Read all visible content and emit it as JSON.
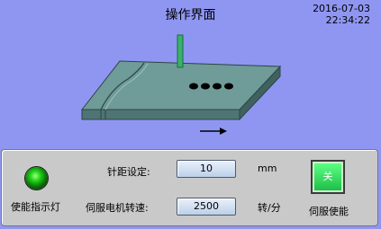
{
  "header": {
    "title": "操作界面",
    "date": "2016-07-03",
    "time": "22:34:22"
  },
  "scene": {
    "holes": 4,
    "arrow_icon": "arrow-right-icon",
    "colors": {
      "table_top": "#6f9b98",
      "table_side": "#4e7573",
      "needle": "#36b36a",
      "hole": "#000000"
    }
  },
  "panel": {
    "indicator_label": "使能指示灯",
    "indicator_state": "on",
    "stitch_spacing": {
      "label": "针距设定:",
      "value": "10",
      "unit": "mm"
    },
    "motor_speed": {
      "label": "伺服电机转速:",
      "value": "2500",
      "unit": "转/分"
    },
    "servo_button": {
      "label": "关",
      "caption": "伺服使能"
    }
  }
}
